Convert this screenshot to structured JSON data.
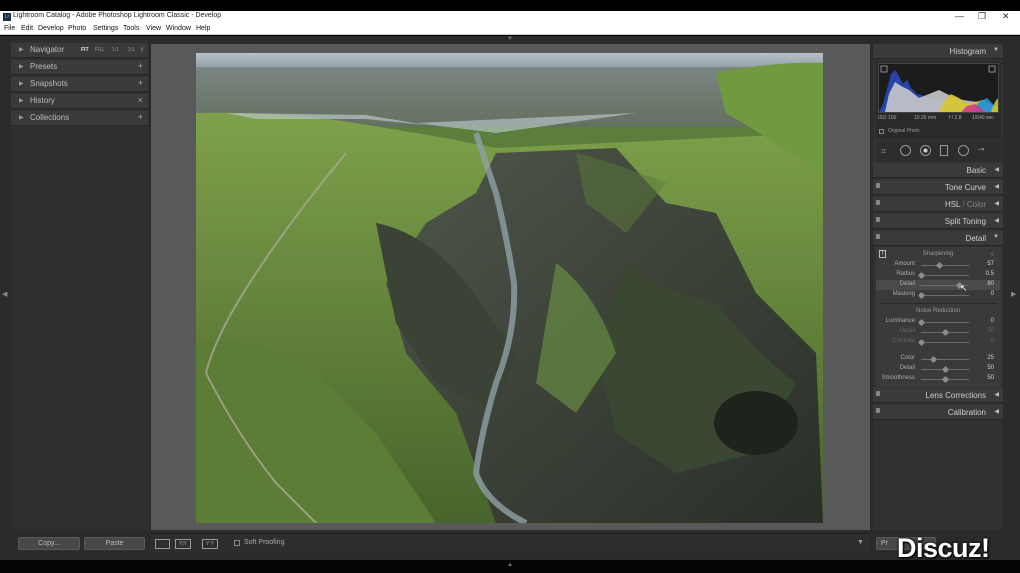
{
  "window": {
    "title": "Lightroom Catalog - Adobe Photoshop Lightroom Classic - Develop",
    "app_icon": "Lr",
    "minimize": "—",
    "restore": "❐",
    "close": "✕"
  },
  "menu": [
    "File",
    "Edit",
    "Develop",
    "Photo",
    "Settings",
    "Tools",
    "View",
    "Window",
    "Help"
  ],
  "left_panel": {
    "navigator": {
      "label": "Navigator",
      "options": [
        "FIT",
        "FILL",
        "1:1",
        "3:1"
      ],
      "selected": "FIT",
      "options_arrow": "⇕"
    },
    "sections": [
      {
        "label": "Presets",
        "action": "+"
      },
      {
        "label": "Snapshots",
        "action": "+"
      },
      {
        "label": "History",
        "action": "×"
      },
      {
        "label": "Collections",
        "action": "+"
      }
    ],
    "copy_label": "Copy...",
    "paste_label": "Paste"
  },
  "toolbar": {
    "soft_proofing": "Soft Proofing",
    "icons": [
      "loupe-view-icon",
      "before-after-icon",
      "yy-compare-icon"
    ]
  },
  "right_panel": {
    "histogram": {
      "label": "Histogram",
      "iso": "ISO 100",
      "focal": "10.26 mm",
      "aperture": "f / 2.8",
      "shutter": "1/640 sec",
      "original_photo": "Original Photo"
    },
    "panels": [
      {
        "label": "Basic",
        "expanded": false
      },
      {
        "label": "Tone Curve",
        "expanded": false
      },
      {
        "label": "HSL",
        "label2": "Color",
        "expanded": false
      },
      {
        "label": "Split Toning",
        "expanded": false
      },
      {
        "label": "Detail",
        "expanded": true
      },
      {
        "label": "Lens Corrections",
        "expanded": false
      },
      {
        "label": "Calibration",
        "expanded": false
      }
    ],
    "detail": {
      "sharpening": {
        "title": "Sharpening",
        "rows": [
          {
            "name": "Amount",
            "value": "57",
            "fraction": 0.38
          },
          {
            "name": "Radius",
            "value": "0.5",
            "fraction": 0.0
          },
          {
            "name": "Detail",
            "value": "80",
            "fraction": 0.8
          },
          {
            "name": "Masking",
            "value": "0",
            "fraction": 0.0
          }
        ]
      },
      "noise_reduction": {
        "title": "Noise Reduction",
        "rows": [
          {
            "name": "Luminance",
            "value": "0",
            "fraction": 0.0,
            "dim": false
          },
          {
            "name": "Detail",
            "value": "50",
            "fraction": 0.5,
            "dim": true
          },
          {
            "name": "Contrast",
            "value": "0",
            "fraction": 0.0,
            "dim": true
          },
          {
            "name": "Color",
            "value": "25",
            "fraction": 0.25,
            "dim": false
          },
          {
            "name": "Detail",
            "value": "50",
            "fraction": 0.5,
            "dim": false
          },
          {
            "name": "Smoothness",
            "value": "50",
            "fraction": 0.5,
            "dim": false
          }
        ]
      }
    },
    "previous_label": "Pr"
  },
  "watermark": "Discuz!"
}
